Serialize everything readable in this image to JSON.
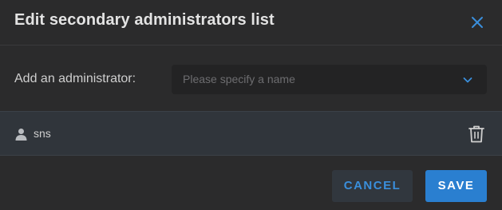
{
  "dialog": {
    "title": "Edit secondary administrators list",
    "close_icon": "close-icon"
  },
  "add_admin": {
    "label": "Add an administrator:",
    "placeholder": "Please specify a name",
    "dropdown_icon": "chevron-down-icon"
  },
  "administrators": [
    {
      "name": "sns",
      "icon": "user-icon",
      "action_icon": "trash-icon"
    }
  ],
  "footer": {
    "cancel_label": "CANCEL",
    "save_label": "SAVE"
  },
  "colors": {
    "background": "#2b2b2c",
    "accent": "#2a7fd0",
    "accent_text": "#3a8fdc",
    "list_row": "#30353b"
  }
}
